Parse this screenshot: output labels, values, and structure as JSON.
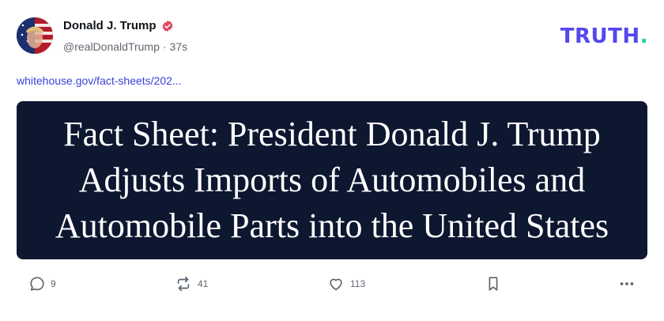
{
  "post": {
    "display_name": "Donald J. Trump",
    "handle": "@realDonaldTrump",
    "separator": "·",
    "time_ago": "37s",
    "link_text": "whitehouse.gov/fact-sheets/202...",
    "card": {
      "line1": "Fact Sheet: President Donald J. Trump",
      "line2": "Adjusts Imports of Automobiles and",
      "line3": "Automobile Parts into the United States"
    }
  },
  "brand": {
    "logo_text": "TRUTH",
    "logo_dot": "."
  },
  "actions": {
    "replies": "9",
    "retruths": "41",
    "likes": "113"
  },
  "colors": {
    "brand_purple": "#5448ee",
    "brand_green": "#17d2a8",
    "link_blue": "#3a41d8",
    "card_bg": "#0d1730",
    "verified_badge": "#e0475f"
  },
  "icons": {
    "reply": "speech-bubble-icon",
    "retruth": "repost-arrows-icon",
    "like": "heart-icon",
    "bookmark": "bookmark-icon",
    "more": "more-dots-icon",
    "verified": "verified-badge-icon"
  }
}
